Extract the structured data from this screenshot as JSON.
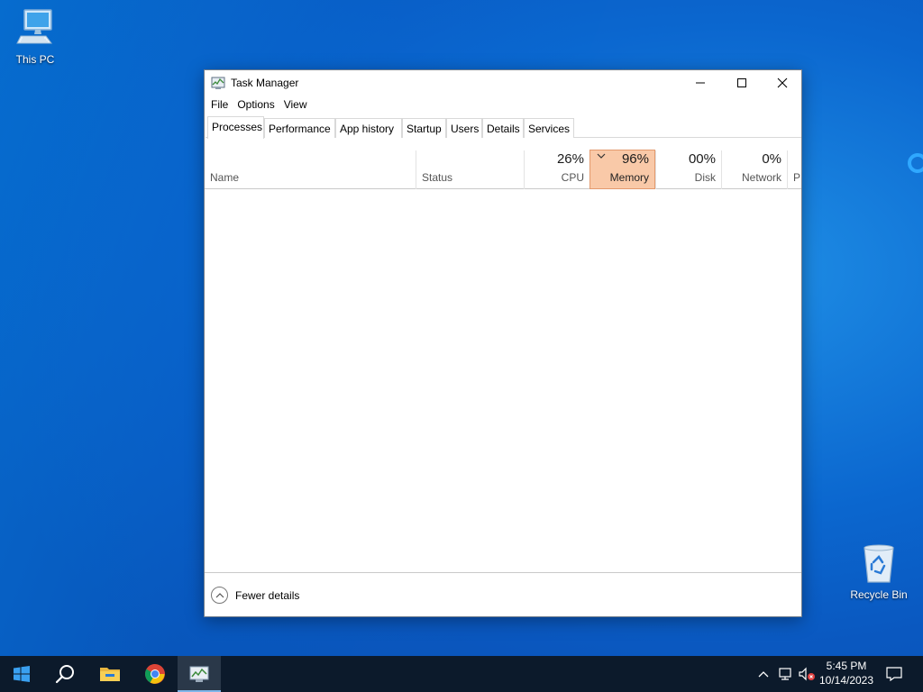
{
  "desktop": {
    "icons": [
      {
        "label": "This PC"
      },
      {
        "label": "Recycle Bin"
      }
    ]
  },
  "window": {
    "title": "Task Manager",
    "controls": {
      "minimize": "—",
      "maximize": "☐",
      "close": "✕"
    }
  },
  "menu": [
    "File",
    "Options",
    "View"
  ],
  "tabs": [
    "Processes",
    "Performance",
    "App history",
    "Startup",
    "Users",
    "Details",
    "Services"
  ],
  "active_tab": "Processes",
  "columns": {
    "name": {
      "label": "Name"
    },
    "status": {
      "label": "Status"
    },
    "cpu": {
      "percent": "26%",
      "label": "CPU"
    },
    "memory": {
      "percent": "96%",
      "label": "Memory"
    },
    "disk": {
      "percent": "00%",
      "label": "Disk"
    },
    "network": {
      "percent": "0%",
      "label": "Network"
    },
    "power": {
      "label": "P"
    }
  },
  "footer": {
    "fewer_details": "Fewer details"
  },
  "taskbar": {
    "apps": [
      "start-icon",
      "search-icon",
      "file-explorer-icon",
      "chrome-icon",
      "task-manager-icon"
    ],
    "clock": {
      "time": "5:45 PM",
      "date": "10/14/2023"
    }
  },
  "colors": {
    "memory_highlight": "#f9c9a8",
    "taskbar": "#0c1a2b",
    "desktop": "#0b67cf"
  }
}
